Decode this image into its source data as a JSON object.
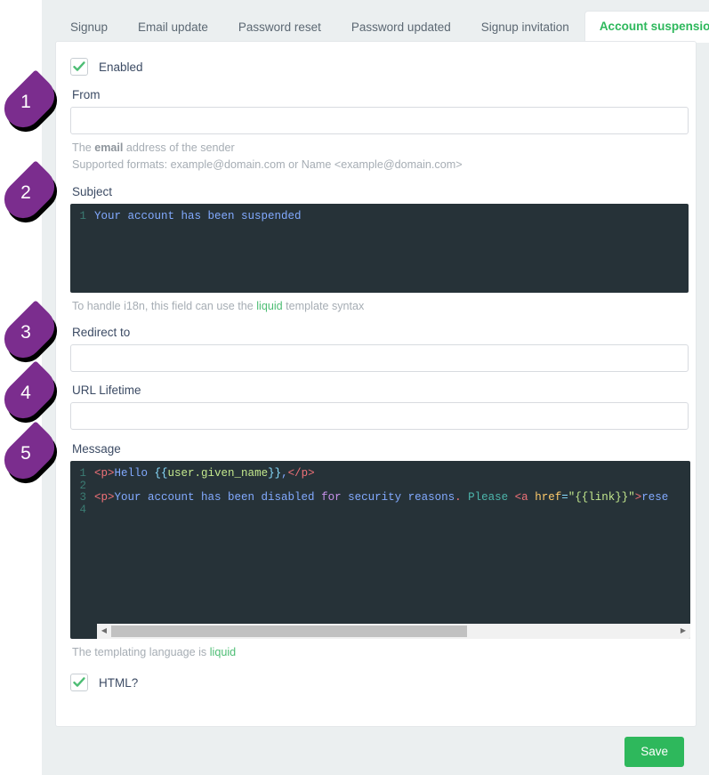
{
  "tabs": [
    {
      "label": "Signup",
      "active": false
    },
    {
      "label": "Email update",
      "active": false
    },
    {
      "label": "Password reset",
      "active": false
    },
    {
      "label": "Password updated",
      "active": false
    },
    {
      "label": "Signup invitation",
      "active": false
    },
    {
      "label": "Account suspension",
      "active": true
    }
  ],
  "form": {
    "enabled_label": "Enabled",
    "enabled_checked": true,
    "from": {
      "label": "From",
      "value": "",
      "placeholder": "",
      "help_prefix": "The ",
      "help_bold": "email",
      "help_suffix": " address of the sender",
      "help_formats": "Supported formats: example@domain.com or Name <example@domain.com>"
    },
    "subject": {
      "label": "Subject",
      "help_prefix": "To handle i18n, this field can use the ",
      "help_link": "liquid",
      "help_suffix": " template syntax",
      "lines": [
        {
          "n": "1",
          "text": "Your account has been suspended"
        }
      ]
    },
    "redirect_to": {
      "label": "Redirect to",
      "value": "",
      "placeholder": ""
    },
    "url_lifetime": {
      "label": "URL Lifetime",
      "value": "",
      "placeholder": ""
    },
    "message": {
      "label": "Message",
      "help_prefix": "The templating language is ",
      "help_link": "liquid",
      "help_suffix": "",
      "lines": [
        {
          "n": "1",
          "text": "<p>Hello {{user.given_name}},</p>"
        },
        {
          "n": "2",
          "text": ""
        },
        {
          "n": "3",
          "text": "<p>Your account has been disabled for security reasons. Please <a href=\"{{link}}\">rese"
        },
        {
          "n": "4",
          "text": ""
        }
      ],
      "scroll_left_arrow": "◀",
      "scroll_right_arrow": "▶"
    },
    "html_label": "HTML?",
    "html_checked": true
  },
  "footer": {
    "save_label": "Save"
  },
  "callouts": [
    {
      "num": "1"
    },
    {
      "num": "2"
    },
    {
      "num": "3"
    },
    {
      "num": "4"
    },
    {
      "num": "5"
    }
  ],
  "colors": {
    "accent_green": "#2eb85c",
    "link_green": "#4dbd74",
    "callout_purple": "#7b2d8e",
    "editor_bg": "#263238",
    "text": "#3c4b64",
    "muted": "#a6adb4"
  }
}
